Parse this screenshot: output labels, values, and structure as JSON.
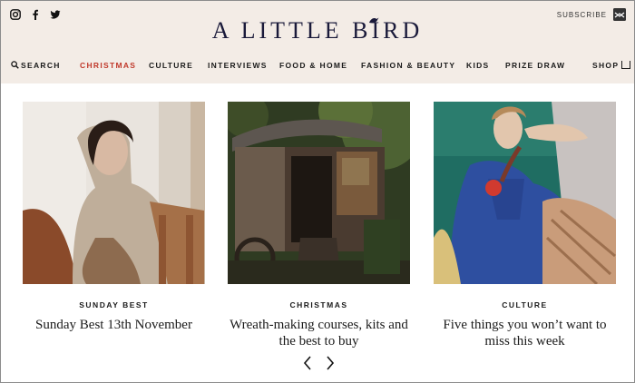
{
  "header": {
    "logo_text": "A LITTLE BIRD",
    "subscribe_label": "SUBSCRIBE",
    "social_icons": [
      "instagram-icon",
      "facebook-icon",
      "twitter-icon"
    ]
  },
  "nav": {
    "search_label": "SEARCH",
    "items": [
      {
        "label": "CHRISTMAS",
        "active": true
      },
      {
        "label": "CULTURE"
      },
      {
        "label": "INTERVIEWS"
      },
      {
        "label": "FOOD & HOME"
      },
      {
        "label": "FASHION & BEAUTY"
      },
      {
        "label": "KIDS"
      },
      {
        "label": "PRIZE DRAW"
      }
    ],
    "shop_label": "SHOP"
  },
  "cards": [
    {
      "category": "SUNDAY BEST",
      "title": "Sunday Best 13th November"
    },
    {
      "category": "CHRISTMAS",
      "title": "Wreath-making courses, kits and the best to buy"
    },
    {
      "category": "CULTURE",
      "title": "Five things you won’t want to miss this week"
    }
  ],
  "colors": {
    "header_bg": "#f3ece6",
    "accent_red": "#c0392b",
    "logo_navy": "#1a1a3a"
  }
}
